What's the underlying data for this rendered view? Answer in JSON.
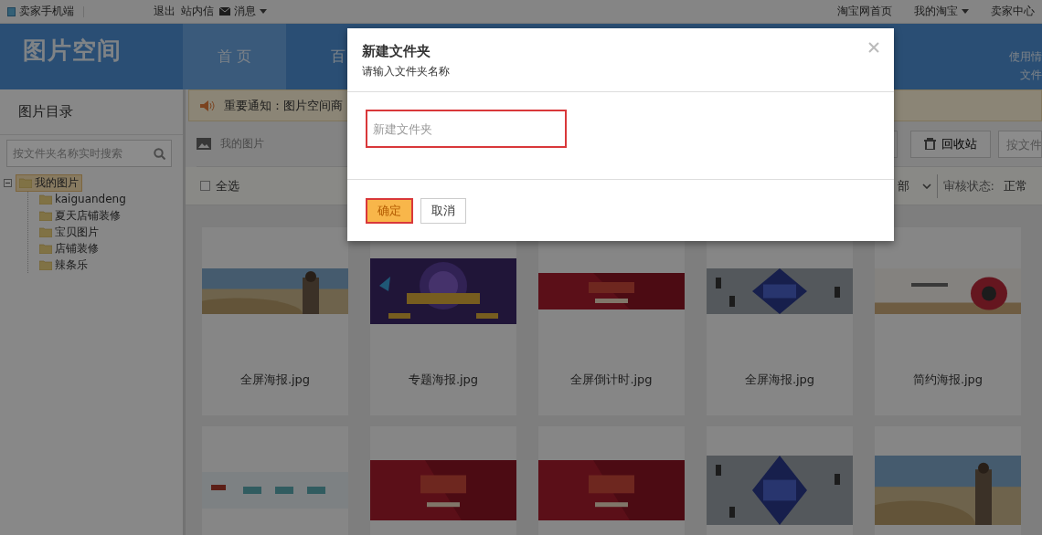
{
  "top_bar": {
    "left": [
      {
        "kind": "phone",
        "label": "卖家手机端"
      },
      {
        "kind": "link",
        "label": "退出"
      },
      {
        "kind": "link",
        "label": "站内信"
      },
      {
        "kind": "mail",
        "label": "消息"
      }
    ],
    "right": [
      {
        "label": "淘宝网首页",
        "dropdown": false
      },
      {
        "label": "我的淘宝",
        "dropdown": true
      },
      {
        "label": "卖家中心",
        "dropdown": false
      }
    ]
  },
  "header": {
    "logo": "图片空间",
    "nav": [
      {
        "label": "首 页",
        "selected": true
      },
      {
        "label": "百",
        "selected": false
      }
    ],
    "right_lines": [
      "使用情",
      "文件"
    ]
  },
  "sidebar": {
    "title": "图片目录",
    "search": {
      "placeholder": "按文件夹名称实时搜索"
    },
    "tree": [
      {
        "label": "我的图片",
        "selected": true,
        "expanded": true,
        "children": [
          {
            "label": "kaiguandeng",
            "selected": false
          },
          {
            "label": "夏天店铺装修",
            "selected": false
          },
          {
            "label": "宝贝图片",
            "selected": false
          },
          {
            "label": "店铺装修",
            "selected": false
          },
          {
            "label": "辣条乐",
            "selected": false
          }
        ]
      }
    ]
  },
  "notice": "重要通知：图片空间商",
  "toolbar": {
    "breadcrumb": "我的图片",
    "buttons": [
      {
        "kind": "partial"
      },
      {
        "kind": "trash",
        "label": "回收站"
      }
    ],
    "search": {
      "placeholder": "按文件"
    }
  },
  "filter_bar": {
    "select_all": {
      "label": "全选",
      "checked": false
    },
    "type_select": "部",
    "status_label": "审核状态:",
    "status_value": "正常"
  },
  "cards": [
    {
      "caption": "全屏海报.jpg",
      "image": {
        "kind": "picture"
      }
    },
    {
      "caption": "专题海报.jpg",
      "image": {
        "kind": "picture"
      }
    },
    {
      "caption": "全屏倒计时.jpg",
      "image": {
        "kind": "picture"
      }
    },
    {
      "caption": "全屏海报.jpg",
      "image": {
        "kind": "picture"
      }
    },
    {
      "caption": "简约海报.jpg",
      "image": {
        "kind": "picture"
      }
    },
    {
      "image": {
        "kind": "picture"
      }
    },
    {
      "image": {
        "kind": "picture"
      }
    },
    {
      "image": {
        "kind": "picture"
      }
    },
    {
      "image": {
        "kind": "picture"
      }
    },
    {
      "image": {
        "kind": "picture"
      }
    }
  ],
  "dialog": {
    "title": "新建文件夹",
    "subtitle": "请输入文件夹名称",
    "input": {
      "placeholder": "新建文件夹"
    },
    "buttons": [
      {
        "label": "确定",
        "primary": true
      },
      {
        "label": "取消",
        "primary": false
      }
    ]
  }
}
